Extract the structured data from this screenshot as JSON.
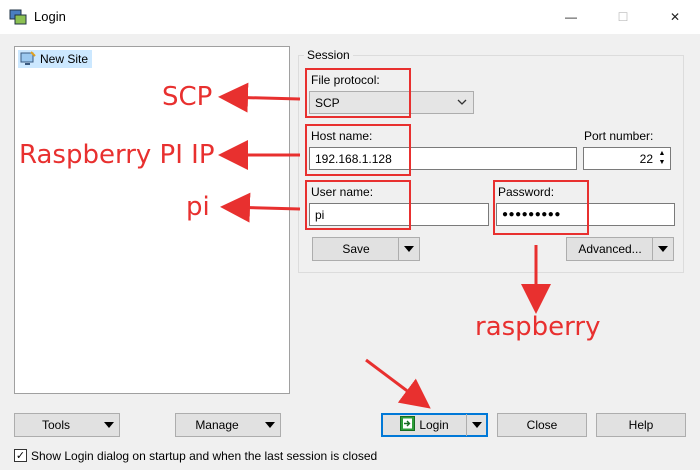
{
  "window": {
    "title": "Login",
    "minimize_glyph": "—",
    "maximize_glyph": "☐",
    "close_glyph": "✕"
  },
  "sites": {
    "items": [
      {
        "label": "New Site",
        "icon": "computer-icon"
      }
    ]
  },
  "session": {
    "group_label": "Session",
    "file_protocol_label": "File protocol:",
    "file_protocol_value": "SCP",
    "host_name_label": "Host name:",
    "host_name_value": "192.168.1.128",
    "port_label": "Port number:",
    "port_value": "22",
    "user_name_label": "User name:",
    "user_name_value": "pi",
    "password_label": "Password:",
    "password_value": "●●●●●●●●●",
    "save_label": "Save",
    "advanced_label": "Advanced..."
  },
  "bottom": {
    "tools_label": "Tools",
    "manage_label": "Manage",
    "login_label": "Login",
    "close_label": "Close",
    "help_label": "Help",
    "show_login_label": "Show Login dialog on startup and when the last session is closed",
    "show_login_checked": true
  },
  "annotations": {
    "scp": "SCP",
    "raspberry_ip": "Raspberry PI IP",
    "pi": "pi",
    "raspberry": "raspberry",
    "color": "#e8302f"
  }
}
